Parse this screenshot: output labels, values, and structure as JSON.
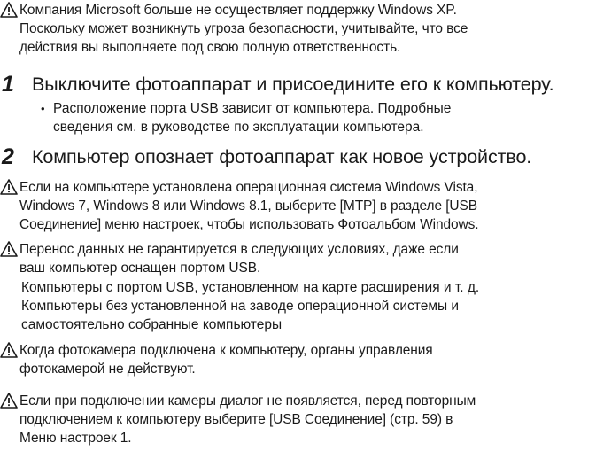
{
  "warning_icon": "warning-triangle-icon",
  "notes": {
    "xp": [
      "Компания Microsoft больше не осуществляет поддержку Windows XP.",
      "Поскольку может возникнуть угроза безопасности, учитывайте, что все",
      "действия вы выполняете под свою полную ответственность."
    ],
    "vista": [
      "Если на компьютере установлена операционная система Windows Vista,",
      "Windows 7, Windows 8 или Windows 8.1, выберите [MTP] в разделе [USB",
      "Соединение] меню настроек, чтобы использовать Фотоальбом Windows."
    ],
    "transfer": [
      "Перенос данных не гарантируется в следующих условиях, даже если",
      "ваш компьютер оснащен портом USB."
    ],
    "transfer_items": [
      "Компьютеры с портом USB, установленном на карте расширения и т. д.",
      "Компьютеры без установленной на заводе операционной системы и",
      "самостоятельно собранные компьютеры"
    ],
    "controls": [
      "Когда фотокамера подключена к компьютеру, органы управления",
      "фотокамерой не действуют."
    ],
    "dialog": [
      "Если при подключении камеры диалог не появляется, перед повторным",
      "подключением к компьютеру выберите [USB Соединение] (стр. 59) в",
      "Меню настроек 1."
    ]
  },
  "steps": [
    {
      "number": "1",
      "title": "Выключите фотоаппарат и присоедините его к компьютеру.",
      "bullet": "•",
      "details": [
        "Расположение порта USB зависит от компьютера. Подробные",
        "сведения см. в руководстве по эксплуатации компьютера."
      ]
    },
    {
      "number": "2",
      "title": "Компьютер опознает фотоаппарат как новое устройство."
    }
  ]
}
